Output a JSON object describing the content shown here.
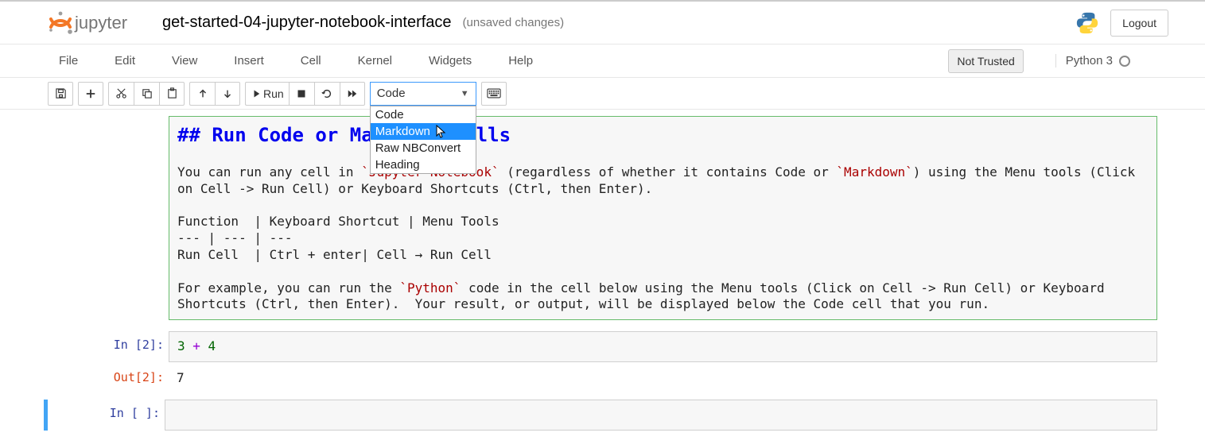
{
  "header": {
    "logo_text": "jupyter",
    "title": "get-started-04-jupyter-notebook-interface",
    "status": "(unsaved changes)",
    "logout": "Logout"
  },
  "menubar": {
    "items": [
      "File",
      "Edit",
      "View",
      "Insert",
      "Cell",
      "Kernel",
      "Widgets",
      "Help"
    ],
    "trust": "Not Trusted",
    "kernel": "Python 3"
  },
  "toolbar": {
    "run_label": "Run",
    "celltype_selected": "Code",
    "celltype_options": [
      "Code",
      "Markdown",
      "Raw NBConvert",
      "Heading"
    ],
    "celltype_hover_index": 1
  },
  "cells": {
    "md": {
      "heading": "## Run Code or Markdown Cells",
      "body1a": "You can run any cell in ",
      "code1": "`Jupyter Notebook`",
      "body1b": " (regardless of whether it contains Code or ",
      "code1x": "`Markdown`",
      "body1c": ") using the Menu tools (Click on Cell -> Run Cell) or Keyboard Shortcuts (Ctrl, then Enter).",
      "table1": "Function  | Keyboard Shortcut | Menu Tools",
      "table2": "--- | --- | ---",
      "table3": "Run Cell  | Ctrl + enter| Cell → Run Cell",
      "body2a": "For example, you can run the ",
      "code2": "`Python`",
      "body2b": " code in the cell below using the Menu tools (Click on Cell -> Run Cell) or Keyboard Shortcuts (Ctrl, then Enter).  Your result, or output, will be displayed below the Code cell that you run."
    },
    "code1": {
      "in_prompt": "In [2]:",
      "out_prompt": "Out[2]:",
      "num1": "3",
      "op": " + ",
      "num2": "4",
      "out_val": "7"
    },
    "code2": {
      "in_prompt": "In [ ]:"
    }
  }
}
